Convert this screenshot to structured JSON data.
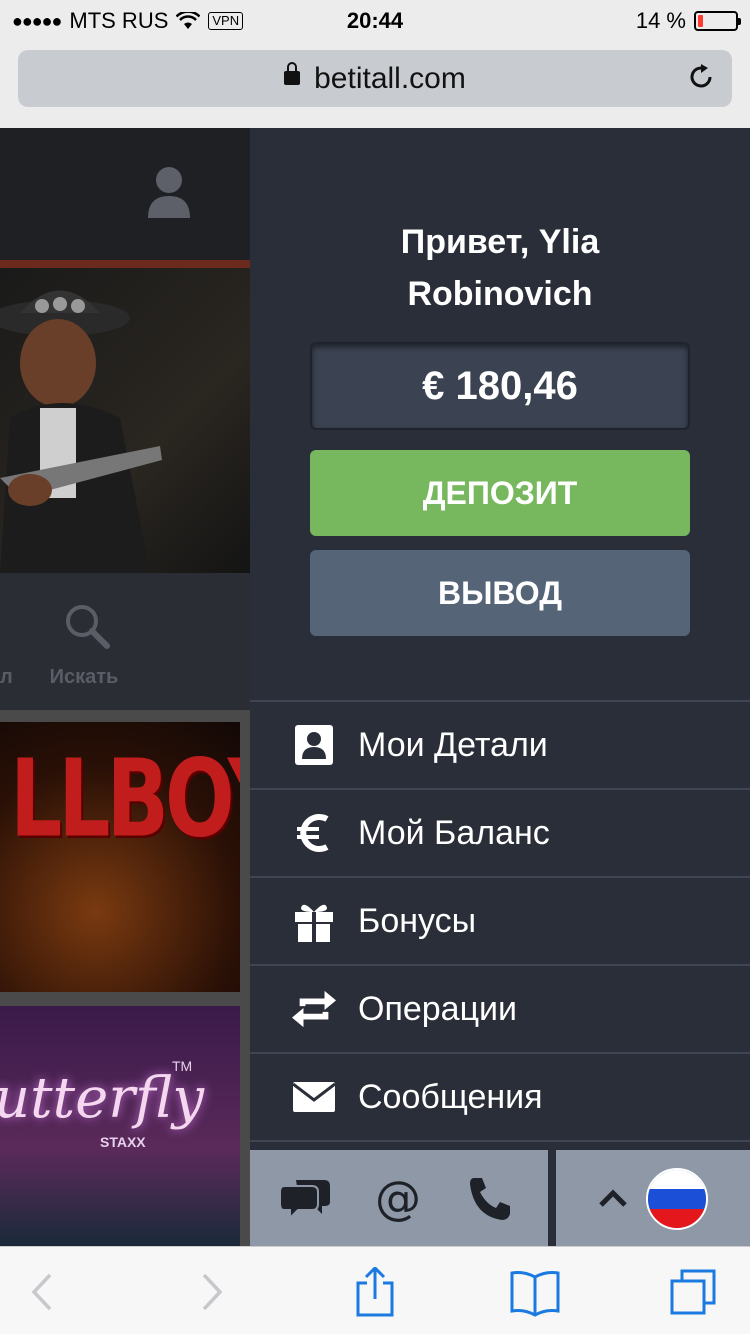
{
  "status_bar": {
    "carrier": "MTS RUS",
    "vpn": "VPN",
    "time": "20:44",
    "battery": "14 %",
    "battery_level": 0.14
  },
  "browser": {
    "url": "betitall.com"
  },
  "background_page": {
    "search_label": "Искать",
    "edge_label": "л",
    "tile1_text": "LLBOY",
    "tile2_text": "utterfly",
    "tile2_sub": "STAXX",
    "tile2_tm": "TM"
  },
  "account_menu": {
    "greeting": "Привет, Ylia Robinovich",
    "balance": "€ 180,46",
    "deposit_label": "ДЕПОЗИТ",
    "withdraw_label": "ВЫВОД",
    "items": [
      {
        "label": "Мои Детали",
        "icon": "user-card-icon"
      },
      {
        "label": "Мой Баланс",
        "icon": "euro-icon"
      },
      {
        "label": "Бонусы",
        "icon": "gift-icon"
      },
      {
        "label": "Операции",
        "icon": "transfer-icon"
      },
      {
        "label": "Сообщения",
        "icon": "envelope-icon"
      }
    ],
    "footer": {
      "contacts": [
        "chat-icon",
        "email-icon",
        "phone-icon"
      ],
      "language_toggle": "chevron-up-icon",
      "language_flag": "russia-flag-icon"
    }
  },
  "colors": {
    "deposit": "#77b85e",
    "withdraw": "#556477",
    "panel": "#2a2e38",
    "safari_blue": "#1a7ae0"
  }
}
